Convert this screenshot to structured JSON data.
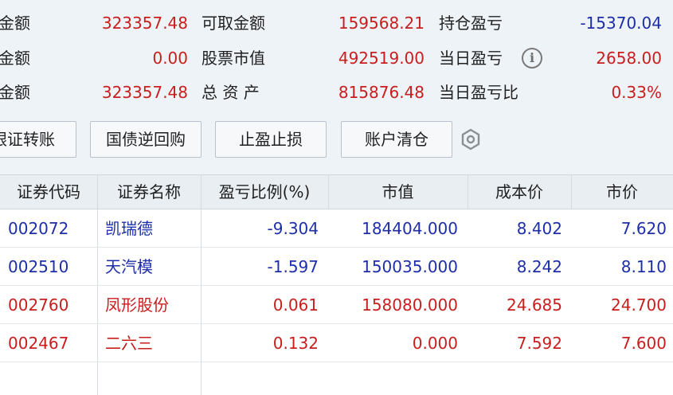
{
  "summary": {
    "row1": {
      "label1": "金额",
      "value1": "323357.48",
      "label2": "可取金额",
      "value2": "159568.21",
      "label3": "持仓盈亏",
      "value3": "-15370.04"
    },
    "row2": {
      "label1": "金额",
      "value1": "0.00",
      "label2": "股票市值",
      "value2": "492519.00",
      "label3": "当日盈亏",
      "value3": "2658.00"
    },
    "row3": {
      "label1": "金额",
      "value1": "323357.48",
      "label2": "总 资 产",
      "value2": "815876.48",
      "label3": "当日盈亏比",
      "value3": "0.33%"
    }
  },
  "info_icon": "info-icon",
  "buttons": {
    "transfer": "银证转账",
    "repo": "国债逆回购",
    "stop": "止盈止损",
    "clear": "账户清仓"
  },
  "settings_icon": "hexagon-settings-icon",
  "table": {
    "headers": [
      "证券代码",
      "证券名称",
      "盈亏比例(%)",
      "市值",
      "成本价",
      "市价"
    ],
    "rows": [
      {
        "code": "002072",
        "name": "凯瑞德",
        "ratio": "-9.304",
        "value": "184404.000",
        "cost": "8.402",
        "price": "7.620",
        "color": "#1e2ea8"
      },
      {
        "code": "002510",
        "name": "天汽模",
        "ratio": "-1.597",
        "value": "150035.000",
        "cost": "8.242",
        "price": "8.110",
        "color": "#1e2ea8"
      },
      {
        "code": "002760",
        "name": "凤形股份",
        "ratio": "0.061",
        "value": "158080.000",
        "cost": "24.685",
        "price": "24.700",
        "color": "#c81e1e"
      },
      {
        "code": "002467",
        "name": "二六三",
        "ratio": "0.132",
        "value": "0.000",
        "cost": "7.592",
        "price": "7.600",
        "color": "#c81e1e"
      }
    ]
  }
}
